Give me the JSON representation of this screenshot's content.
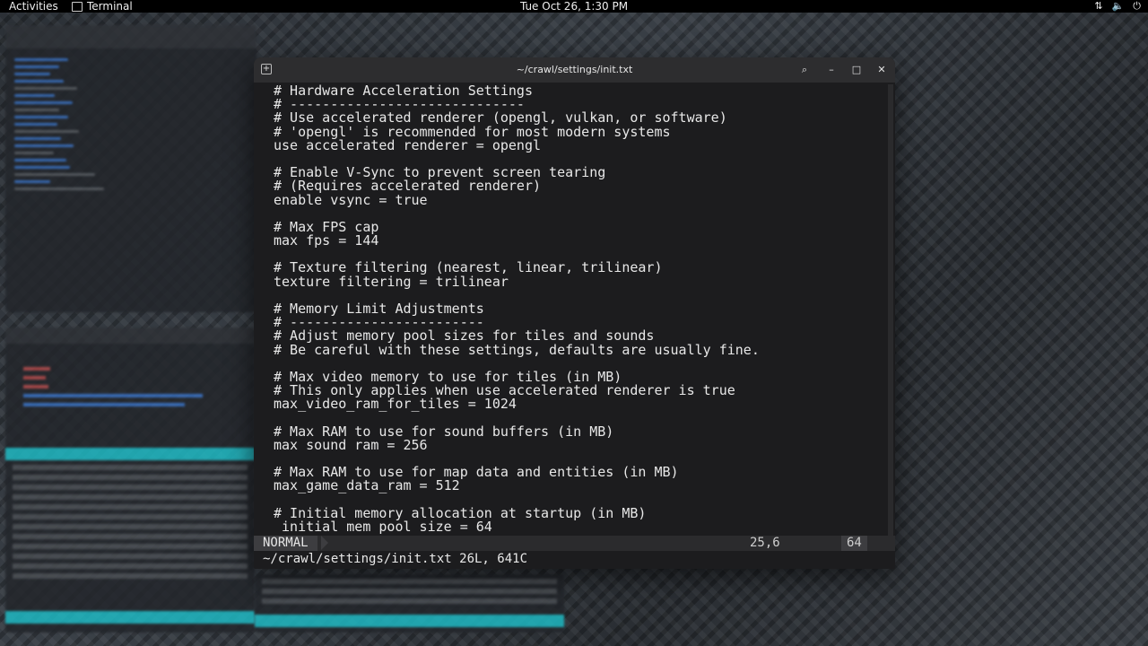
{
  "topbar": {
    "activities": "Activities",
    "app_name": "Terminal",
    "clock": "Tue Oct 26, 1:30 PM"
  },
  "window": {
    "title": "~/crawl/settings/init.txt"
  },
  "editor": {
    "lines": [
      "# Hardware Acceleration Settings",
      "# -----------------------------",
      "# Use accelerated renderer (opengl, vulkan, or software)",
      "# 'opengl' is recommended for most modern systems",
      "use_accelerated_renderer = opengl",
      "",
      "# Enable V-Sync to prevent screen tearing",
      "# (Requires accelerated renderer)",
      "enable_vsync = true",
      "",
      "# Max FPS cap",
      "max_fps = 144",
      "",
      "# Texture filtering (nearest, linear, trilinear)",
      "texture_filtering = trilinear",
      "",
      "# Memory Limit Adjustments",
      "# ------------------------",
      "# Adjust memory pool sizes for tiles and sounds",
      "# Be careful with these settings, defaults are usually fine.",
      "",
      "# Max video memory to use for tiles (in MB)",
      "# This only applies when use_accelerated_renderer is true",
      "max_video_ram_for_tiles = 1024",
      "",
      "# Max RAM to use for sound buffers (in MB)",
      "max_sound_ram = 256",
      "",
      "# Max RAM to use for map data and entities (in MB)",
      "max_game_data_ram = 512",
      "",
      "# Initial memory allocation at startup (in MB)",
      " initial_mem_pool_size = 64"
    ]
  },
  "status": {
    "mode": "NORMAL",
    "position": "25,6",
    "percent": "64"
  },
  "cmdline": "~/crawl/settings/init.txt 26L, 641C",
  "colors": {
    "terminal_bg": "#1c1c1e",
    "htop_accent": "#1fb8c2"
  }
}
